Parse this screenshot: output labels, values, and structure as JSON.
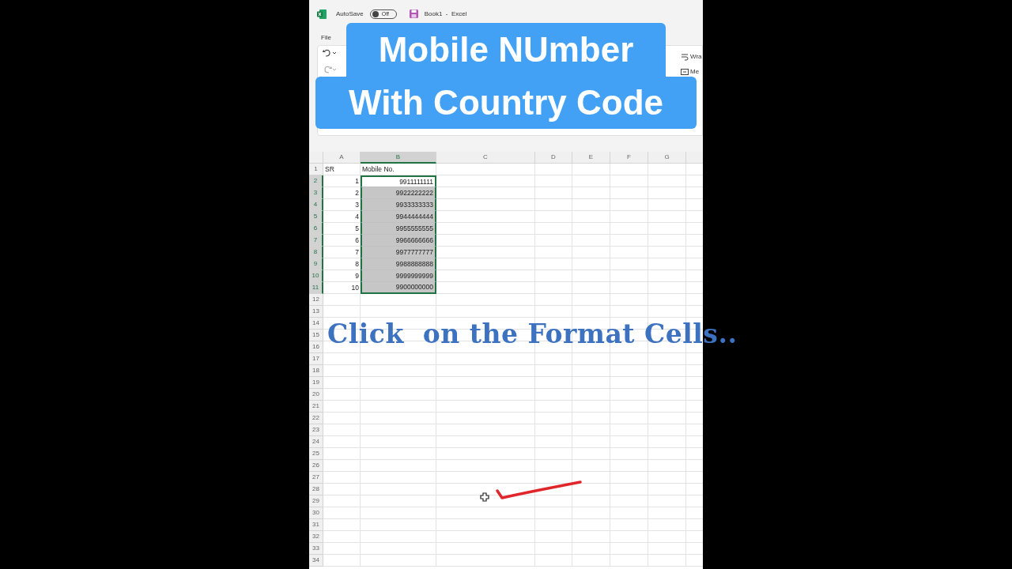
{
  "title_bar": {
    "autosave_label": "AutoSave",
    "autosave_on": false,
    "autosave_state": "Off",
    "document_title": "Book1  -  Excel"
  },
  "ribbon": {
    "file_tab": "File",
    "partial_labels": [
      "Wra",
      "Me"
    ]
  },
  "caption": {
    "lines": [
      "Mobile NUmber",
      "With Country Code"
    ]
  },
  "sheet": {
    "columns": [
      {
        "label": "A",
        "selected": false
      },
      {
        "label": "B",
        "selected": true
      },
      {
        "label": "C",
        "selected": false
      },
      {
        "label": "D",
        "selected": false
      },
      {
        "label": "E",
        "selected": false
      },
      {
        "label": "F",
        "selected": false
      },
      {
        "label": "G",
        "selected": false
      }
    ],
    "rows": [
      {
        "n": "1",
        "cells": [
          "SR",
          "Mobile No."
        ],
        "selected": false,
        "active": false
      },
      {
        "n": "2",
        "cells": [
          "1",
          "9911111111"
        ],
        "selected": true,
        "active": true
      },
      {
        "n": "3",
        "cells": [
          "2",
          "9922222222"
        ],
        "selected": true,
        "active": false
      },
      {
        "n": "4",
        "cells": [
          "3",
          "9933333333"
        ],
        "selected": true,
        "active": false
      },
      {
        "n": "5",
        "cells": [
          "4",
          "9944444444"
        ],
        "selected": true,
        "active": false
      },
      {
        "n": "6",
        "cells": [
          "5",
          "9955555555"
        ],
        "selected": true,
        "active": false
      },
      {
        "n": "7",
        "cells": [
          "6",
          "9966666666"
        ],
        "selected": true,
        "active": false
      },
      {
        "n": "8",
        "cells": [
          "7",
          "9977777777"
        ],
        "selected": true,
        "active": false
      },
      {
        "n": "9",
        "cells": [
          "8",
          "9988888888"
        ],
        "selected": true,
        "active": false
      },
      {
        "n": "10",
        "cells": [
          "9",
          "9999999999"
        ],
        "selected": true,
        "active": false
      },
      {
        "n": "11",
        "cells": [
          "10",
          "9900000000"
        ],
        "selected": true,
        "active": false
      },
      {
        "n": "12",
        "selected": false,
        "active": false
      },
      {
        "n": "13",
        "selected": false,
        "active": false
      },
      {
        "n": "14",
        "selected": false,
        "active": false
      },
      {
        "n": "15",
        "selected": false,
        "active": false
      },
      {
        "n": "16",
        "selected": false,
        "active": false
      },
      {
        "n": "17",
        "selected": false,
        "active": false
      },
      {
        "n": "18",
        "selected": false,
        "active": false
      },
      {
        "n": "19",
        "selected": false,
        "active": false
      },
      {
        "n": "20",
        "selected": false,
        "active": false
      },
      {
        "n": "21",
        "selected": false,
        "active": false
      },
      {
        "n": "22",
        "selected": false,
        "active": false
      },
      {
        "n": "23",
        "selected": false,
        "active": false
      },
      {
        "n": "24",
        "selected": false,
        "active": false
      },
      {
        "n": "25",
        "selected": false,
        "active": false
      },
      {
        "n": "26",
        "selected": false,
        "active": false
      },
      {
        "n": "27",
        "selected": false,
        "active": false
      },
      {
        "n": "28",
        "selected": false,
        "active": false
      },
      {
        "n": "29",
        "selected": false,
        "active": false
      },
      {
        "n": "30",
        "selected": false,
        "active": false
      },
      {
        "n": "31",
        "selected": false,
        "active": false
      },
      {
        "n": "32",
        "selected": false,
        "active": false
      },
      {
        "n": "33",
        "selected": false,
        "active": false
      },
      {
        "n": "34",
        "selected": false,
        "active": false
      }
    ]
  },
  "instruction": "Click  on the Format Cells.."
}
